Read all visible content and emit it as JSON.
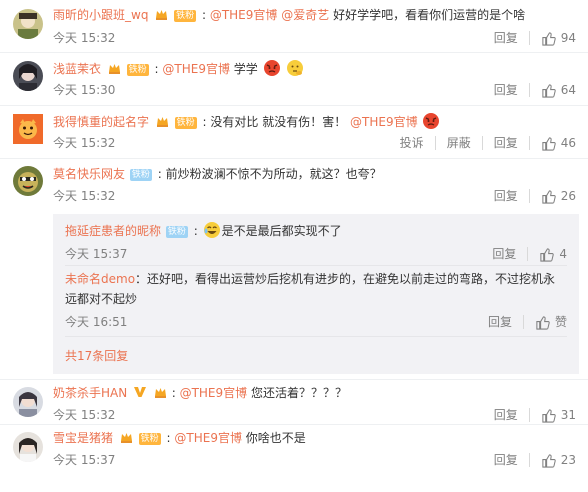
{
  "comments": [
    {
      "user": "雨昕的小跟班_wq",
      "fan_badge": "铁粉",
      "mention": "@THE9官博",
      "mention2": "@爱奇艺",
      "text": "好好学学吧，看看你们运营的是个啥",
      "time": "今天 15:32",
      "reply_label": "回复",
      "likes": "94"
    },
    {
      "user": "浅蓝茉衣",
      "fan_badge": "铁粉",
      "mention": "@THE9官博",
      "text": "学学",
      "time": "今天 15:30",
      "reply_label": "回复",
      "likes": "64"
    },
    {
      "user": "我得慎重的起名字",
      "fan_badge": "铁粉",
      "text": "没有对比 就没有伤！害！",
      "mention": "@THE9官博",
      "time": "今天 15:32",
      "report_label": "投诉",
      "block_label": "屏蔽",
      "reply_label": "回复",
      "likes": "46"
    },
    {
      "user": "莫名快乐网友",
      "fan_badge": "铁粉",
      "text": "前炒粉波澜不惊不为所动，就这？也夸？",
      "time": "今天 15:32",
      "reply_label": "回复",
      "likes": "26"
    },
    {
      "user": "奶茶杀手HAN",
      "mention": "@THE9官博",
      "text": "您还活着？？？？",
      "time": "今天 15:32",
      "reply_label": "回复",
      "likes": "31"
    },
    {
      "user": "雪宝是猪猪",
      "fan_badge": "铁粉",
      "mention": "@THE9官博",
      "text": "你啥也不是",
      "time": "今天 15:37",
      "reply_label": "回复",
      "likes": "23"
    }
  ],
  "replies": [
    {
      "user": "拖延症患者的昵称",
      "fan_badge": "铁粉",
      "text": "是不是最后都实现不了",
      "time": "今天 15:37",
      "reply_label": "回复",
      "likes": "4"
    },
    {
      "user": "未命名demo",
      "text_line1": "：还好吧，看得出运营炒后挖机有进步的，在避免以前走过的弯路，不过挖机永",
      "text_line2": "远都对不起炒",
      "time": "今天 16:51",
      "reply_label": "回复",
      "likes": "赞"
    }
  ],
  "more_replies": "共17条回复",
  "colors": {
    "accent": "#eb7350",
    "meta": "#808080",
    "reply_bg": "#f2f2f5"
  }
}
